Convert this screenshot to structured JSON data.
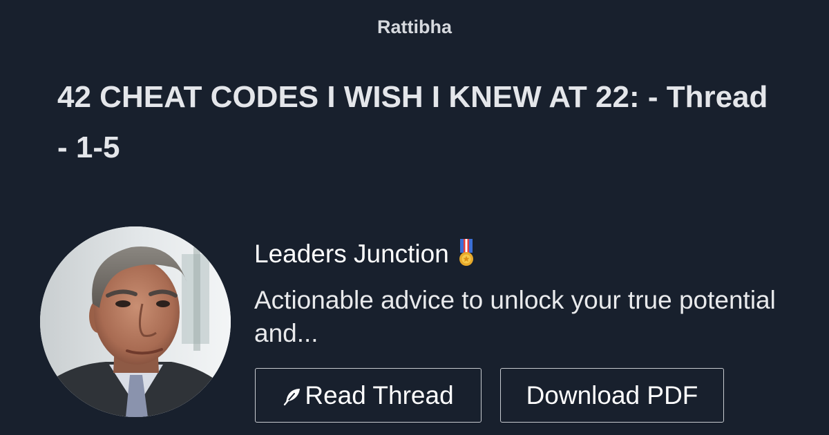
{
  "header": {
    "site_name": "Rattibha"
  },
  "thread": {
    "title": "42 CHEAT CODES I WISH I KNEW AT 22: - Thread - 1-5"
  },
  "author": {
    "name": "Leaders Junction",
    "badge_icon": "military-medal-icon",
    "bio": "Actionable advice to unlock your true potential and..."
  },
  "actions": {
    "read_label": "Read Thread",
    "read_icon": "feather-icon",
    "pdf_label": "Download PDF"
  },
  "colors": {
    "background": "#18202d",
    "title_text": "#e4e6ea",
    "button_border": "#c9ccd1"
  }
}
